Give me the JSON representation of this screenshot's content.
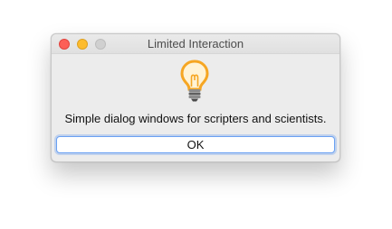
{
  "window": {
    "title": "Limited Interaction"
  },
  "dialog": {
    "icon": "lightbulb-icon",
    "message": "Simple dialog windows for scripters and scientists.",
    "ok_label": "OK"
  },
  "colors": {
    "close": "#fc5f57",
    "minimize": "#fdbc2e",
    "zoom_disabled": "#d0d0d0",
    "bulb_glow": "#f6a623",
    "focus_ring": "#6aa1f3"
  }
}
